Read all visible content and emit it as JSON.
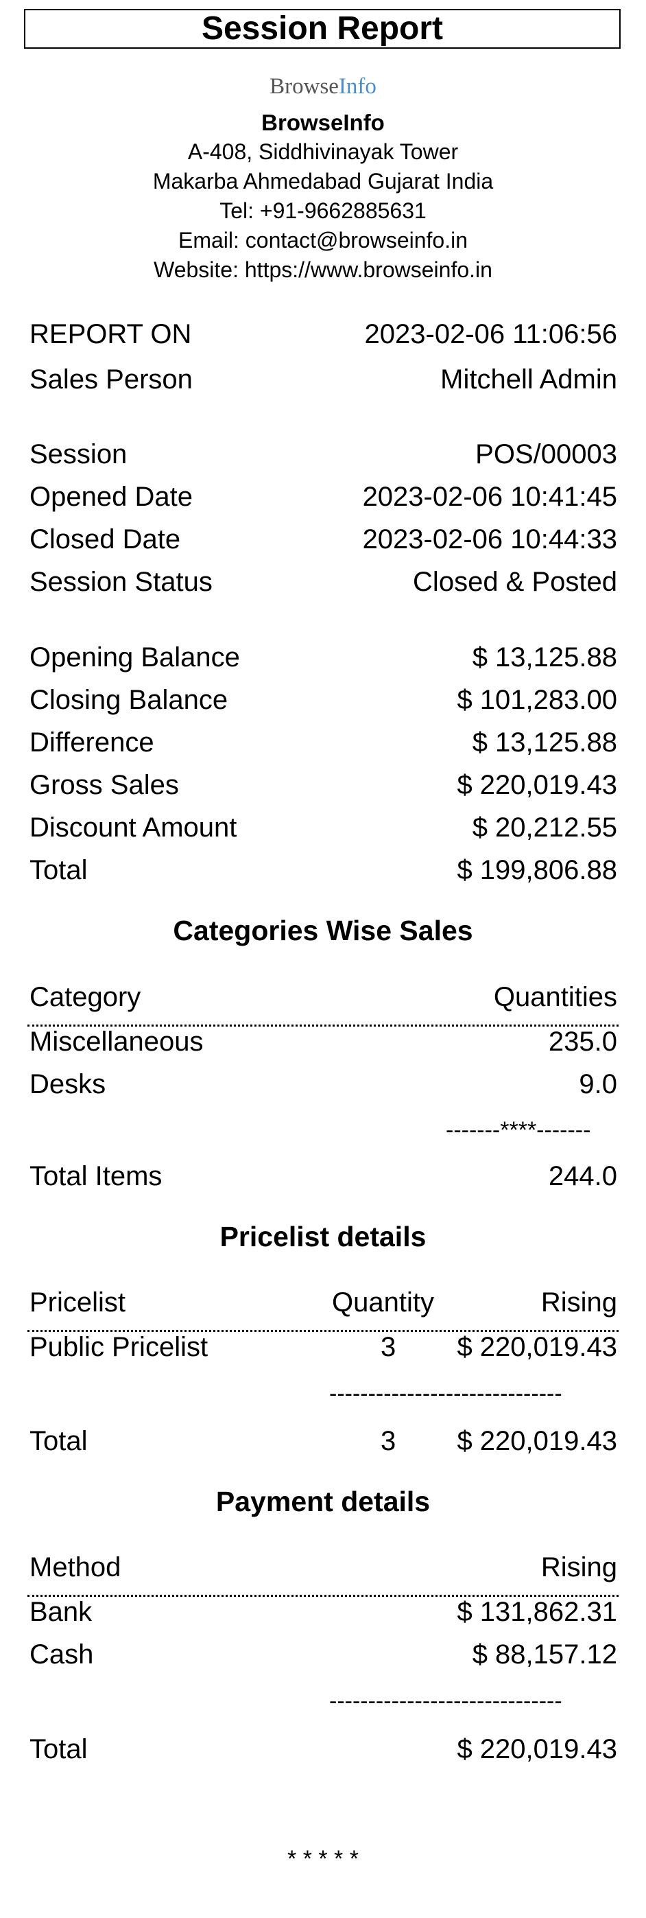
{
  "title": "Session Report",
  "logo": {
    "part1": "Browse",
    "part2": "Info"
  },
  "company": {
    "name": "BrowseInfo",
    "address1": "A-408, Siddhivinayak Tower",
    "address2": "Makarba Ahmedabad Gujarat India",
    "tel": "Tel: +91-9662885631",
    "email": "Email: contact@browseinfo.in",
    "website": "Website: https://www.browseinfo.in"
  },
  "report": {
    "report_on_label": "REPORT ON",
    "report_on_value": "2023-02-06 11:06:56",
    "sales_person_label": "Sales Person",
    "sales_person_value": "Mitchell Admin"
  },
  "session": {
    "session_label": "Session",
    "session_value": "POS/00003",
    "opened_label": "Opened Date",
    "opened_value": "2023-02-06 10:41:45",
    "closed_label": "Closed Date",
    "closed_value": "2023-02-06 10:44:33",
    "status_label": "Session Status",
    "status_value": "Closed & Posted"
  },
  "balances": {
    "opening_label": "Opening Balance",
    "opening_value": "$ 13,125.88",
    "closing_label": "Closing Balance",
    "closing_value": "$ 101,283.00",
    "difference_label": "Difference",
    "difference_value": "$ 13,125.88",
    "gross_label": "Gross Sales",
    "gross_value": "$ 220,019.43",
    "discount_label": "Discount Amount",
    "discount_value": "$ 20,212.55",
    "total_label": "Total",
    "total_value": "$ 199,806.88"
  },
  "categories": {
    "title": "Categories Wise Sales",
    "col_category": "Category",
    "col_quantities": "Quantities",
    "rows": [
      {
        "name": "Miscellaneous",
        "qty": "235.0"
      },
      {
        "name": "Desks",
        "qty": "9.0"
      }
    ],
    "separator": "-------****-------",
    "total_label": "Total Items",
    "total_value": "244.0"
  },
  "pricelist": {
    "title": "Pricelist details",
    "col_pricelist": "Pricelist",
    "col_quantity": "Quantity",
    "col_rising": "Rising",
    "rows": [
      {
        "name": "Public Pricelist",
        "qty": "3",
        "rising": "$ 220,019.43"
      }
    ],
    "separator": "------------------------------",
    "total_label": "Total",
    "total_qty": "3",
    "total_rising": "$ 220,019.43"
  },
  "payment": {
    "title": "Payment details",
    "col_method": "Method",
    "col_rising": "Rising",
    "rows": [
      {
        "name": "Bank",
        "rising": "$ 131,862.31"
      },
      {
        "name": "Cash",
        "rising": "$ 88,157.12"
      }
    ],
    "separator": "------------------------------",
    "total_label": "Total",
    "total_rising": "$ 220,019.43"
  },
  "footer": {
    "stars": "* * * * *"
  }
}
